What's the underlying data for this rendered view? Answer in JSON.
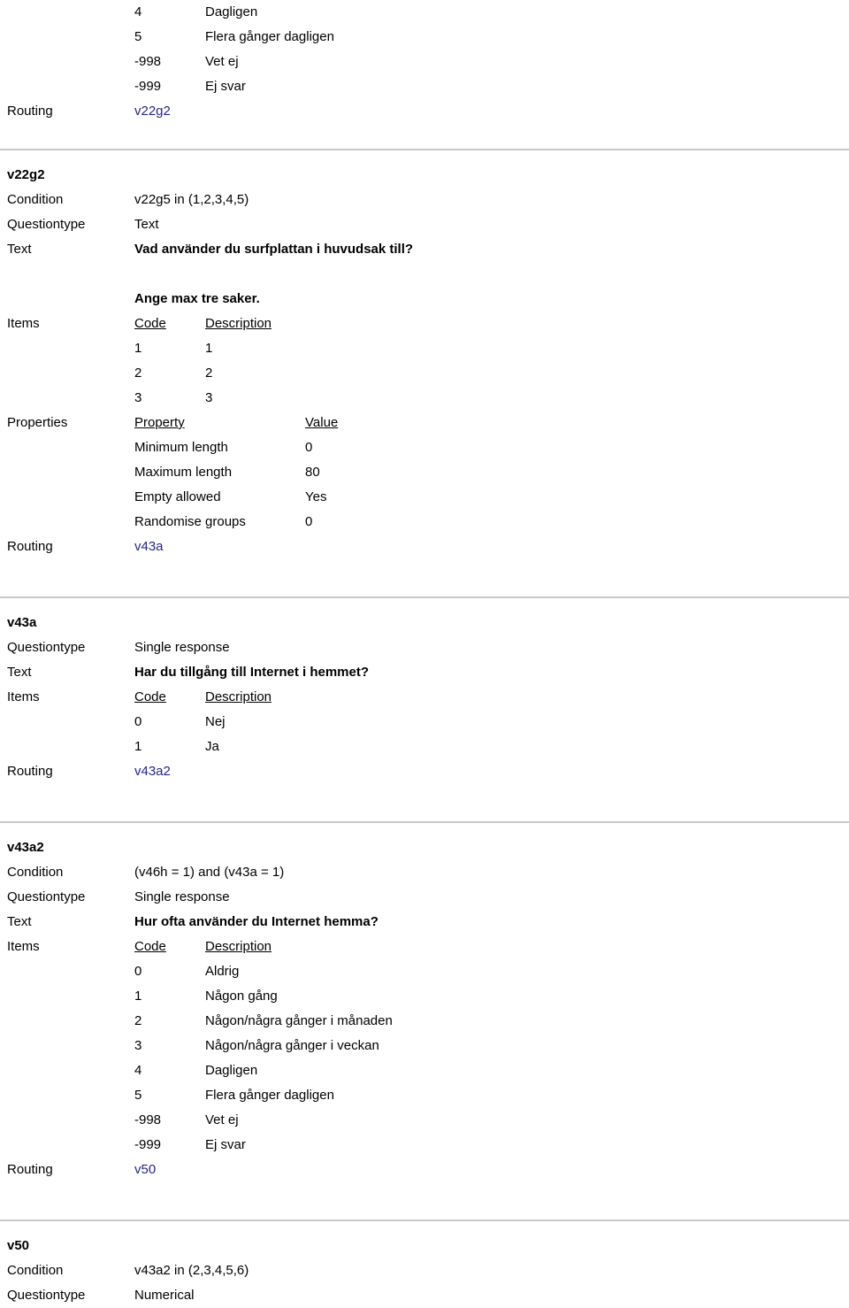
{
  "labels": {
    "condition": "Condition",
    "questiontype": "Questiontype",
    "text": "Text",
    "items": "Items",
    "properties": "Properties",
    "routing": "Routing",
    "code": "Code",
    "description": "Description",
    "property": "Property",
    "value": "Value"
  },
  "colors": {
    "link": "#26268c",
    "divider": "#c9c9c9",
    "text": "#000000",
    "background": "#ffffff"
  },
  "continued_items": [
    {
      "code": "4",
      "description": "Dagligen"
    },
    {
      "code": "5",
      "description": "Flera gånger dagligen"
    },
    {
      "code": "-998",
      "description": "Vet ej"
    },
    {
      "code": "-999",
      "description": "Ej svar"
    }
  ],
  "continued_routing": "v22g2",
  "blocks": [
    {
      "id": "v22g2",
      "condition": "v22g5 in (1,2,3,4,5)",
      "questiontype": "Text",
      "question_text_line1": "Vad använder du surfplattan i huvudsak till?",
      "question_text_line2": "Ange max tre saker.",
      "items": [
        {
          "code": "1",
          "description": "1"
        },
        {
          "code": "2",
          "description": "2"
        },
        {
          "code": "3",
          "description": "3"
        }
      ],
      "properties": [
        {
          "property": "Minimum length",
          "value": "0"
        },
        {
          "property": "Maximum length",
          "value": "80"
        },
        {
          "property": "Empty allowed",
          "value": "Yes"
        },
        {
          "property": "Randomise groups",
          "value": "0"
        }
      ],
      "routing": "v43a"
    },
    {
      "id": "v43a",
      "questiontype": "Single response",
      "question_text_line1": "Har du tillgång till Internet i hemmet?",
      "items": [
        {
          "code": "0",
          "description": "Nej"
        },
        {
          "code": "1",
          "description": "Ja"
        }
      ],
      "routing": "v43a2"
    },
    {
      "id": "v43a2",
      "condition": "(v46h = 1) and (v43a = 1)",
      "questiontype": "Single response",
      "question_text_line1": "Hur ofta använder du Internet hemma?",
      "items": [
        {
          "code": "0",
          "description": "Aldrig"
        },
        {
          "code": "1",
          "description": "Någon gång"
        },
        {
          "code": "2",
          "description": "Någon/några gånger i månaden"
        },
        {
          "code": "3",
          "description": "Någon/några gånger i veckan"
        },
        {
          "code": "4",
          "description": "Dagligen"
        },
        {
          "code": "5",
          "description": "Flera gånger dagligen"
        },
        {
          "code": "-998",
          "description": "Vet ej"
        },
        {
          "code": "-999",
          "description": "Ej svar"
        }
      ],
      "routing": "v50"
    },
    {
      "id": "v50",
      "condition": "v43a2 in (2,3,4,5,6)",
      "questiontype": "Numerical"
    }
  ]
}
